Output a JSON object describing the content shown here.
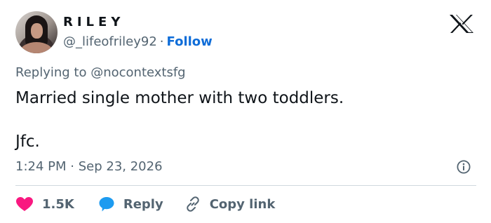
{
  "author": {
    "display_name": "RILEY",
    "handle": "@_lifeofriley92",
    "separator": "·",
    "follow_label": "Follow"
  },
  "tweet": {
    "replying_to": "Replying to @nocontextsfg",
    "body_line1": "Married single mother with two toddlers.",
    "body_line2": "Jfc.",
    "time": "1:24 PM",
    "meta_separator": "·",
    "date": "Sep 23, 2026"
  },
  "actions": {
    "like_count": "1.5K",
    "reply_label": "Reply",
    "copy_label": "Copy link"
  },
  "icons": {
    "brand": "x-logo-icon",
    "info": "info-icon",
    "like": "heart-icon",
    "reply": "chat-bubble-icon",
    "copy": "link-icon"
  },
  "colors": {
    "text": "#0f1419",
    "secondary": "#536471",
    "follow": "#0f6dd8",
    "heart": "#f91880",
    "reply_bubble": "#1d9bf0",
    "divider": "#cfd9de"
  }
}
